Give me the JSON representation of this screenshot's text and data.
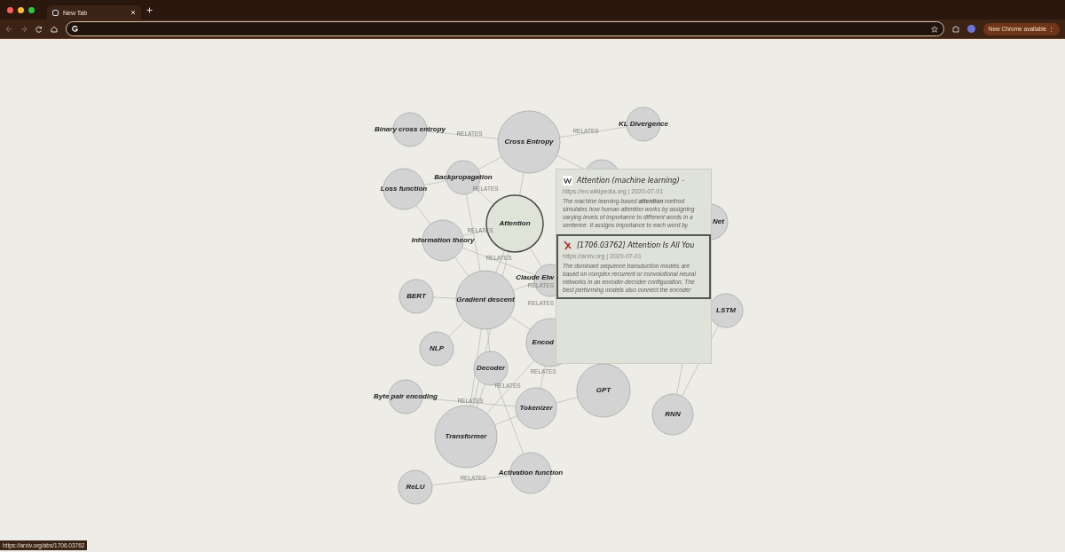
{
  "browser": {
    "tabs": [
      {
        "title": "New Tab",
        "selected": true
      }
    ],
    "update_button": "New Chrome available",
    "update_menu": "⋮"
  },
  "graph": {
    "nodes": [
      {
        "label": "Binary cross entropy",
        "selected": false
      },
      {
        "label": "Cross Entropy",
        "selected": false
      },
      {
        "label": "KL Divergence",
        "selected": false
      },
      {
        "label": "Backpropagation",
        "selected": false
      },
      {
        "label": "Loss function",
        "selected": false
      },
      {
        "label": "Attention",
        "selected": true
      },
      {
        "label": "Information theory",
        "selected": false
      },
      {
        "selected": false
      },
      {
        "label": "Net",
        "selected": false
      },
      {
        "label": "Claude Elw",
        "selected": false
      },
      {
        "label": "BERT",
        "selected": false
      },
      {
        "label": "Gradient descent",
        "selected": false
      },
      {
        "label": "LSTM",
        "selected": false
      },
      {
        "label": "NLP",
        "selected": false
      },
      {
        "label": "Encod",
        "selected": false
      },
      {
        "label": "Decoder",
        "selected": false
      },
      {
        "label": "Byte pair encoding",
        "selected": false
      },
      {
        "label": "GPT",
        "selected": false
      },
      {
        "label": "Tokenizer",
        "selected": false
      },
      {
        "label": "RNN",
        "selected": false
      },
      {
        "label": "Transformer",
        "selected": false
      },
      {
        "label": "Activation function",
        "selected": false
      },
      {
        "label": "ReLU",
        "selected": false
      }
    ],
    "edge_labels": [
      "RELATES",
      "RELATES",
      "RELATES",
      "RELATES",
      "RELATES",
      "RELATES",
      "RELATES",
      "RELATES",
      "RELATES",
      "RELATES",
      "RELATES"
    ]
  },
  "popup": {
    "cards": [
      {
        "kind": "wikipedia",
        "title": "Attention (machine learning) -",
        "source": "https://en.wikipedia.org | 2020-07-01",
        "text": "The machine learning-based **attention** method simulates how human attention works by assigning varying levels of importance to different words in a sentence. It assigns importance to each word by",
        "selected": false
      },
      {
        "kind": "arxiv",
        "title": "[1706.03762] Attention Is All You",
        "source": "https://arxiv.org | 2020-07-01",
        "text": "The dominant sequence transduction models are based on complex recurrent or convolutional neural networks in an encoder-decoder configuration. The best performing models also connect the encoder",
        "selected": true
      }
    ]
  },
  "status_url": "https://arxiv.org/abs/1706.03762"
}
